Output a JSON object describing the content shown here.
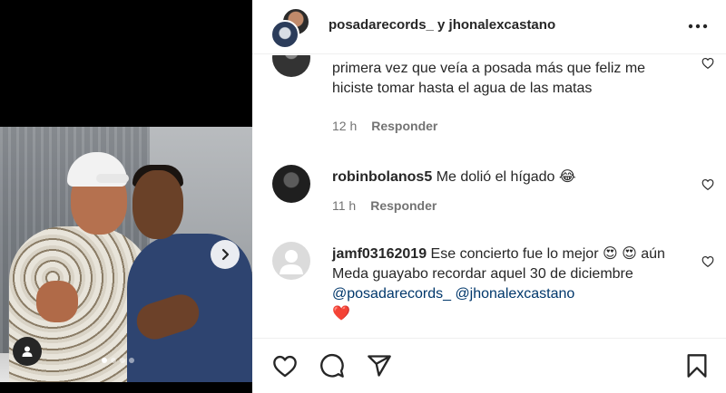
{
  "header": {
    "title": "posadarecords_ y jhonalexcastano"
  },
  "media": {
    "carousel": {
      "total": 4,
      "active": 1
    }
  },
  "comments": [
    {
      "username": "",
      "text": "primera vez que veía a posada más que feliz me hiciste tomar hasta el agua de las matas",
      "time": "12 h",
      "reply": "Responder"
    },
    {
      "username": "robinbolanos5",
      "text": "Me dolió el hígado",
      "emoji": "😂",
      "time": "11 h",
      "reply": "Responder"
    },
    {
      "username": "jamf03162019",
      "text": "Ese concierto fue lo mejor",
      "emoji": "😍 😍",
      "text2": "aún Meda guayabo recordar aquel 30 de diciembre",
      "mention1": "@posadarecords_",
      "mention2": "@jhonalexcastano",
      "emoji2": "❤️"
    }
  ],
  "actions": {
    "like": "heart-icon",
    "comment": "comment-icon",
    "share": "share-icon",
    "save": "bookmark-icon"
  }
}
